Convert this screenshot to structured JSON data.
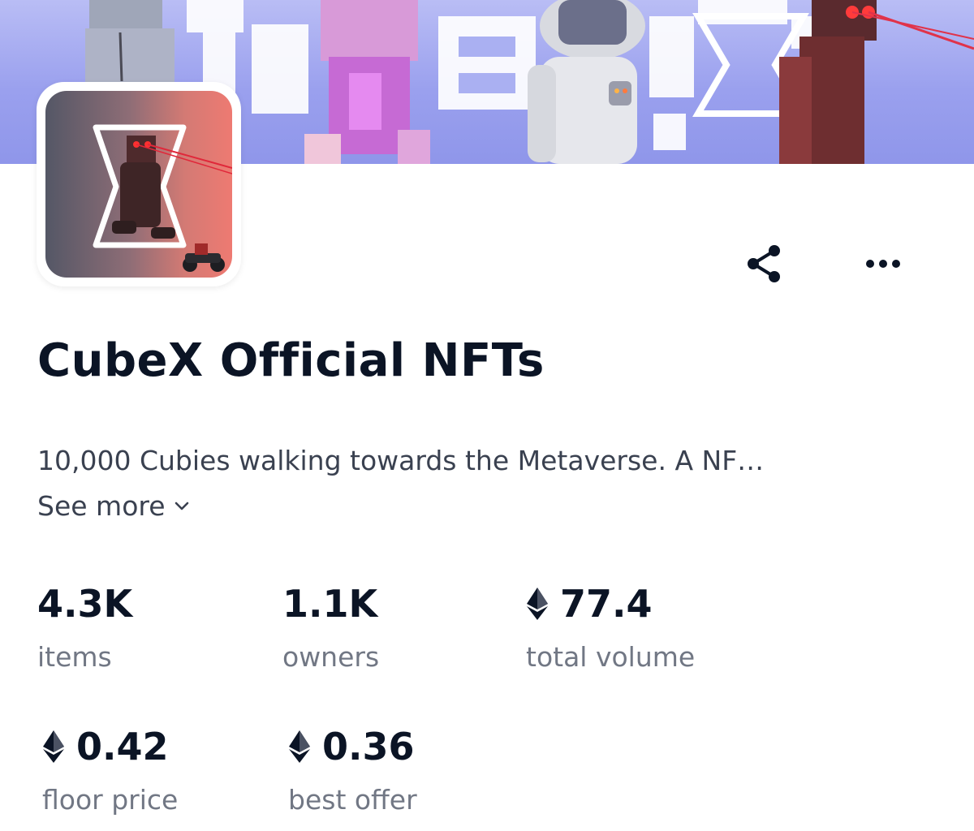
{
  "collection": {
    "title": "CubeX Official NFTs",
    "description": "10,000 Cubies walking towards the Metaverse. A NF…",
    "see_more_label": "See more"
  },
  "actions": {
    "share_icon": "share-icon",
    "more_icon": "more-horizontal-icon"
  },
  "stats": [
    {
      "value": "4.3K",
      "label": "items",
      "currency_icon": null
    },
    {
      "value": "1.1K",
      "label": "owners",
      "currency_icon": null
    },
    {
      "value": "77.4",
      "label": "total volume",
      "currency_icon": "ethereum-icon"
    },
    {
      "value": "0.42",
      "label": "floor price",
      "currency_icon": "ethereum-icon"
    },
    {
      "value": "0.36",
      "label": "best offer",
      "currency_icon": "ethereum-icon"
    }
  ],
  "colors": {
    "text_primary": "#0b1425",
    "text_secondary": "#717784",
    "banner_bg": "#9aa0ee"
  }
}
